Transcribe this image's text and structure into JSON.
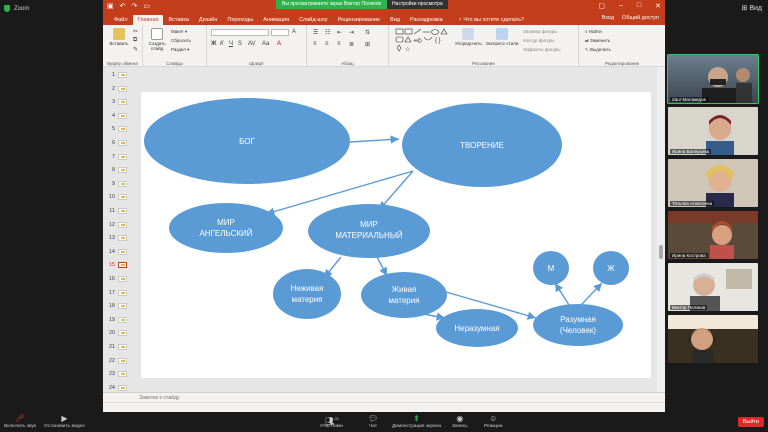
{
  "zoom": {
    "title": "Zoom",
    "view_label": "Вид",
    "toolbar": {
      "mute": "Включить звук",
      "video": "Остановить видео",
      "participants": "Участники",
      "participants_count": "22",
      "chat": "Чат",
      "share": "Демонстрация экрана",
      "record": "Запись",
      "reactions": "Реакции",
      "leave": "Выйти"
    },
    "participants": [
      {
        "name": "Zaur Магомедов"
      },
      {
        "name": "Ирина Валерьева"
      },
      {
        "name": "Татьяна Алексеева"
      },
      {
        "name": "Ирина Кострова"
      },
      {
        "name": "Виктор Поляков"
      },
      {
        "name": ""
      }
    ]
  },
  "powerpoint": {
    "notice_text": "Вы просматриваете экран Виктор Поляков",
    "notice_options": "Настройки просмотра",
    "menu_tabs": [
      "Файл",
      "Главная",
      "Вставка",
      "Дизайн",
      "Переходы",
      "Анимация",
      "Слайд-шоу",
      "Рецензирование",
      "Вид",
      "Раскадровка"
    ],
    "active_tab": "Главная",
    "search_placeholder": "Что вы хотите сделать?",
    "menu_right": [
      "Вход",
      "Общий доступ"
    ],
    "ribbon": {
      "clipboard": {
        "name": "Буфер обмена",
        "paste": "Вставить"
      },
      "slides": {
        "name": "Слайды",
        "new_slide": "Создать слайд",
        "layout": "Макет",
        "reset": "Сбросить",
        "section": "Раздел"
      },
      "font": {
        "name": "Шрифт"
      },
      "paragraph": {
        "name": "Абзац"
      },
      "drawing": {
        "name": "Рисование",
        "arrange": "Упорядочить",
        "quick_styles": "Экспресс-стили",
        "fill": "Заливка фигуры",
        "outline": "Контур фигуры",
        "effects": "Эффекты фигуры"
      },
      "editing": {
        "name": "Редактирование",
        "find": "Найти",
        "replace": "Заменить",
        "select": "Выделить"
      }
    },
    "thumbnail_count": 24,
    "selected_slide": 15,
    "notes_placeholder": "Заметки к слайду"
  },
  "slide": {
    "nodes": {
      "god": "БОГ",
      "creation": "ТВОРЕНИЕ",
      "angelic_1": "МИР",
      "angelic_2": "АНГЕЛЬСКИЙ",
      "material_1": "МИР",
      "material_2": "МАТЕРИАЛЬНЫЙ",
      "inanimate_1": "Неживая",
      "inanimate_2": "материя",
      "living_1": "Живая",
      "living_2": "материя",
      "irrational": "Неразумная",
      "rational_1": "Разумная",
      "rational_2": "(Человек)",
      "m": "М",
      "f": "Ж"
    },
    "colors": {
      "node": "#5b9bd5",
      "accent": "#c43e1c"
    }
  }
}
